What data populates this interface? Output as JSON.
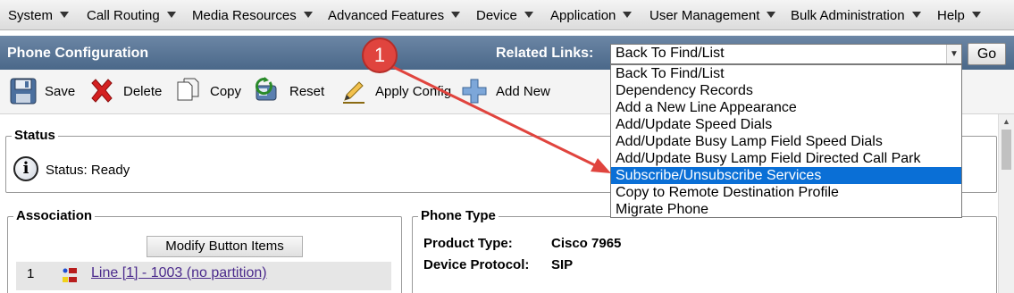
{
  "menu": {
    "items": [
      {
        "label": "System"
      },
      {
        "label": "Call Routing"
      },
      {
        "label": "Media Resources"
      },
      {
        "label": "Advanced Features"
      },
      {
        "label": "Device"
      },
      {
        "label": "Application"
      },
      {
        "label": "User Management"
      },
      {
        "label": "Bulk Administration"
      },
      {
        "label": "Help"
      }
    ]
  },
  "header": {
    "title": "Phone Configuration",
    "related_links_label": "Related Links:",
    "related_links_value": "Back To Find/List",
    "go_label": "Go"
  },
  "toolbar": {
    "save": "Save",
    "delete": "Delete",
    "copy": "Copy",
    "reset": "Reset",
    "apply_config": "Apply Config",
    "add_new": "Add New"
  },
  "status": {
    "legend": "Status",
    "text": "Status: Ready"
  },
  "association": {
    "legend": "Association",
    "modify_button": "Modify Button Items",
    "rows": [
      {
        "num": "1",
        "link": "Line [1] - 1003 (no partition)"
      }
    ]
  },
  "phone_type": {
    "legend": "Phone Type",
    "product_type_label": "Product Type:",
    "product_type_value": "Cisco 7965",
    "device_protocol_label": "Device Protocol:",
    "device_protocol_value": "SIP"
  },
  "dropdown": {
    "options": [
      {
        "label": "Back To Find/List"
      },
      {
        "label": "Dependency Records"
      },
      {
        "label": "Add a New Line Appearance"
      },
      {
        "label": "Add/Update Speed Dials"
      },
      {
        "label": "Add/Update Busy Lamp Field Speed Dials"
      },
      {
        "label": "Add/Update Busy Lamp Field Directed Call Park"
      },
      {
        "label": "Subscribe/Unsubscribe Services"
      },
      {
        "label": "Copy to Remote Destination Profile"
      },
      {
        "label": "Migrate Phone"
      }
    ],
    "selected": "Subscribe/Unsubscribe Services"
  },
  "callout": {
    "number": "1"
  },
  "colors": {
    "title_bar": "#4a6889",
    "highlight": "#0a6fd6",
    "callout": "#e0443e",
    "link": "#4b2a8c"
  }
}
